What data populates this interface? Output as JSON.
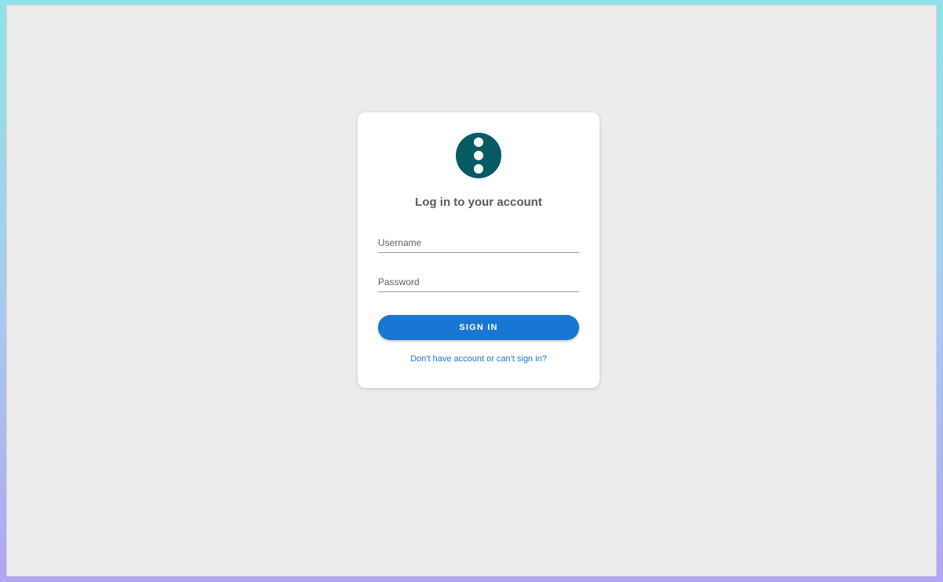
{
  "login": {
    "title": "Log in to your account",
    "username_placeholder": "Username",
    "password_placeholder": "Password",
    "signin_label": "SIGN IN",
    "help_link": "Don't have account or can't sign in?"
  },
  "colors": {
    "logo": "#055a63",
    "primary": "#1976d2",
    "background": "#ececec"
  },
  "icons": {
    "logo": "vertical-dots-logo-icon"
  }
}
